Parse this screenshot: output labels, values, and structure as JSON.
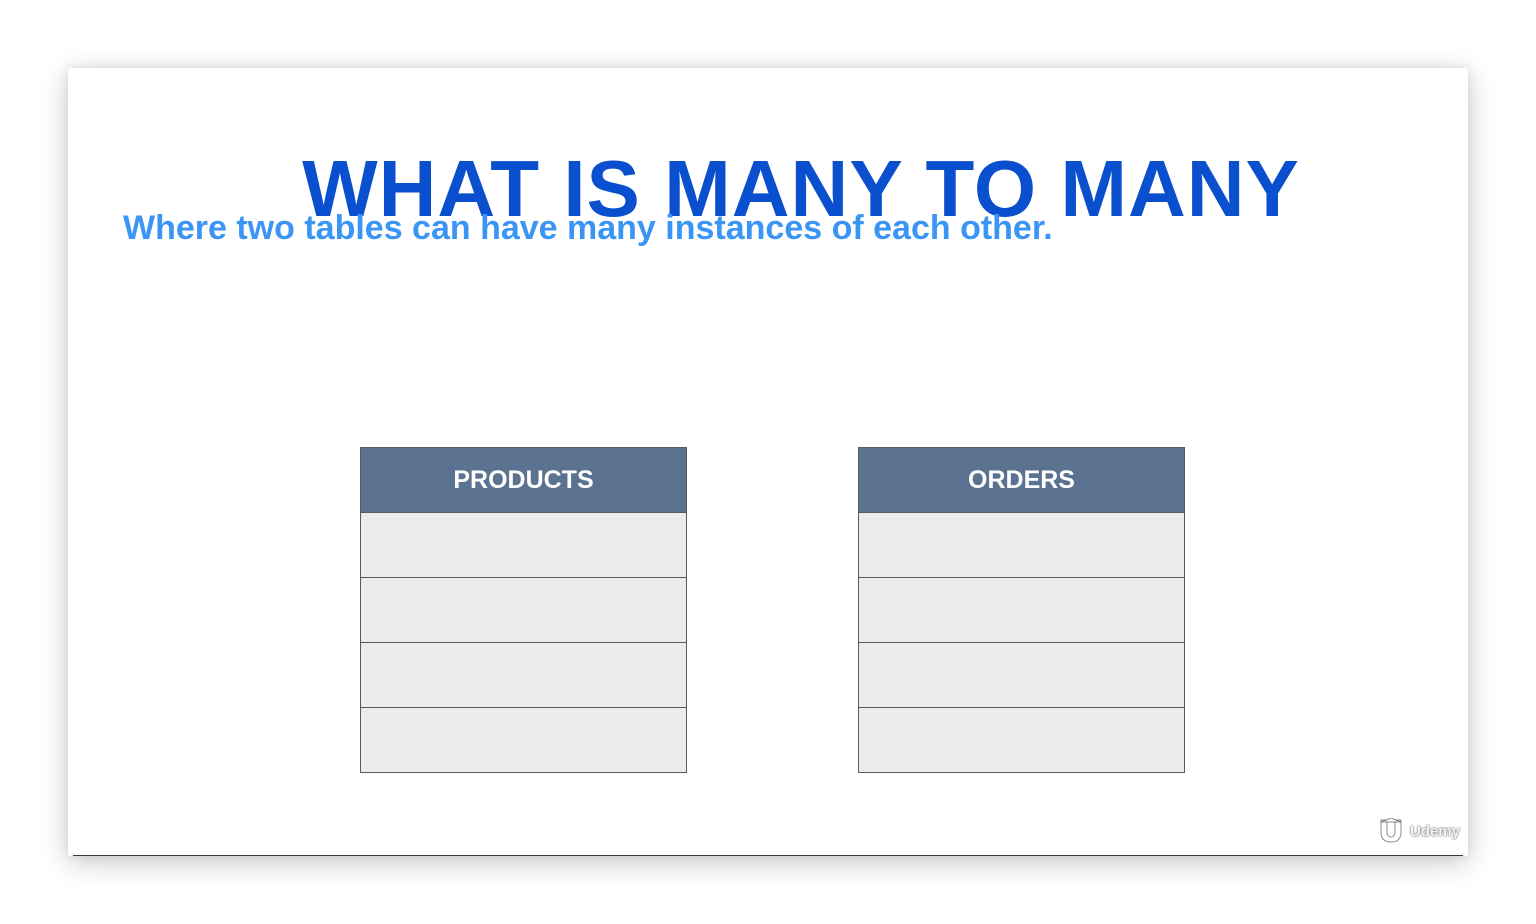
{
  "slide": {
    "title": "WHAT IS MANY TO MANY",
    "subtitle": "Where two tables can have many instances of each other."
  },
  "tables": [
    {
      "name": "PRODUCTS",
      "rows": [
        "",
        "",
        "",
        ""
      ]
    },
    {
      "name": "ORDERS",
      "rows": [
        "",
        "",
        "",
        ""
      ]
    }
  ],
  "watermark": {
    "text": "Udemy",
    "icon": "udemy-logo-icon"
  },
  "colors": {
    "title": "#0a4fce",
    "subtitle": "#3b95f5",
    "table_header": "#5b7290",
    "table_row": "#ebebeb"
  }
}
